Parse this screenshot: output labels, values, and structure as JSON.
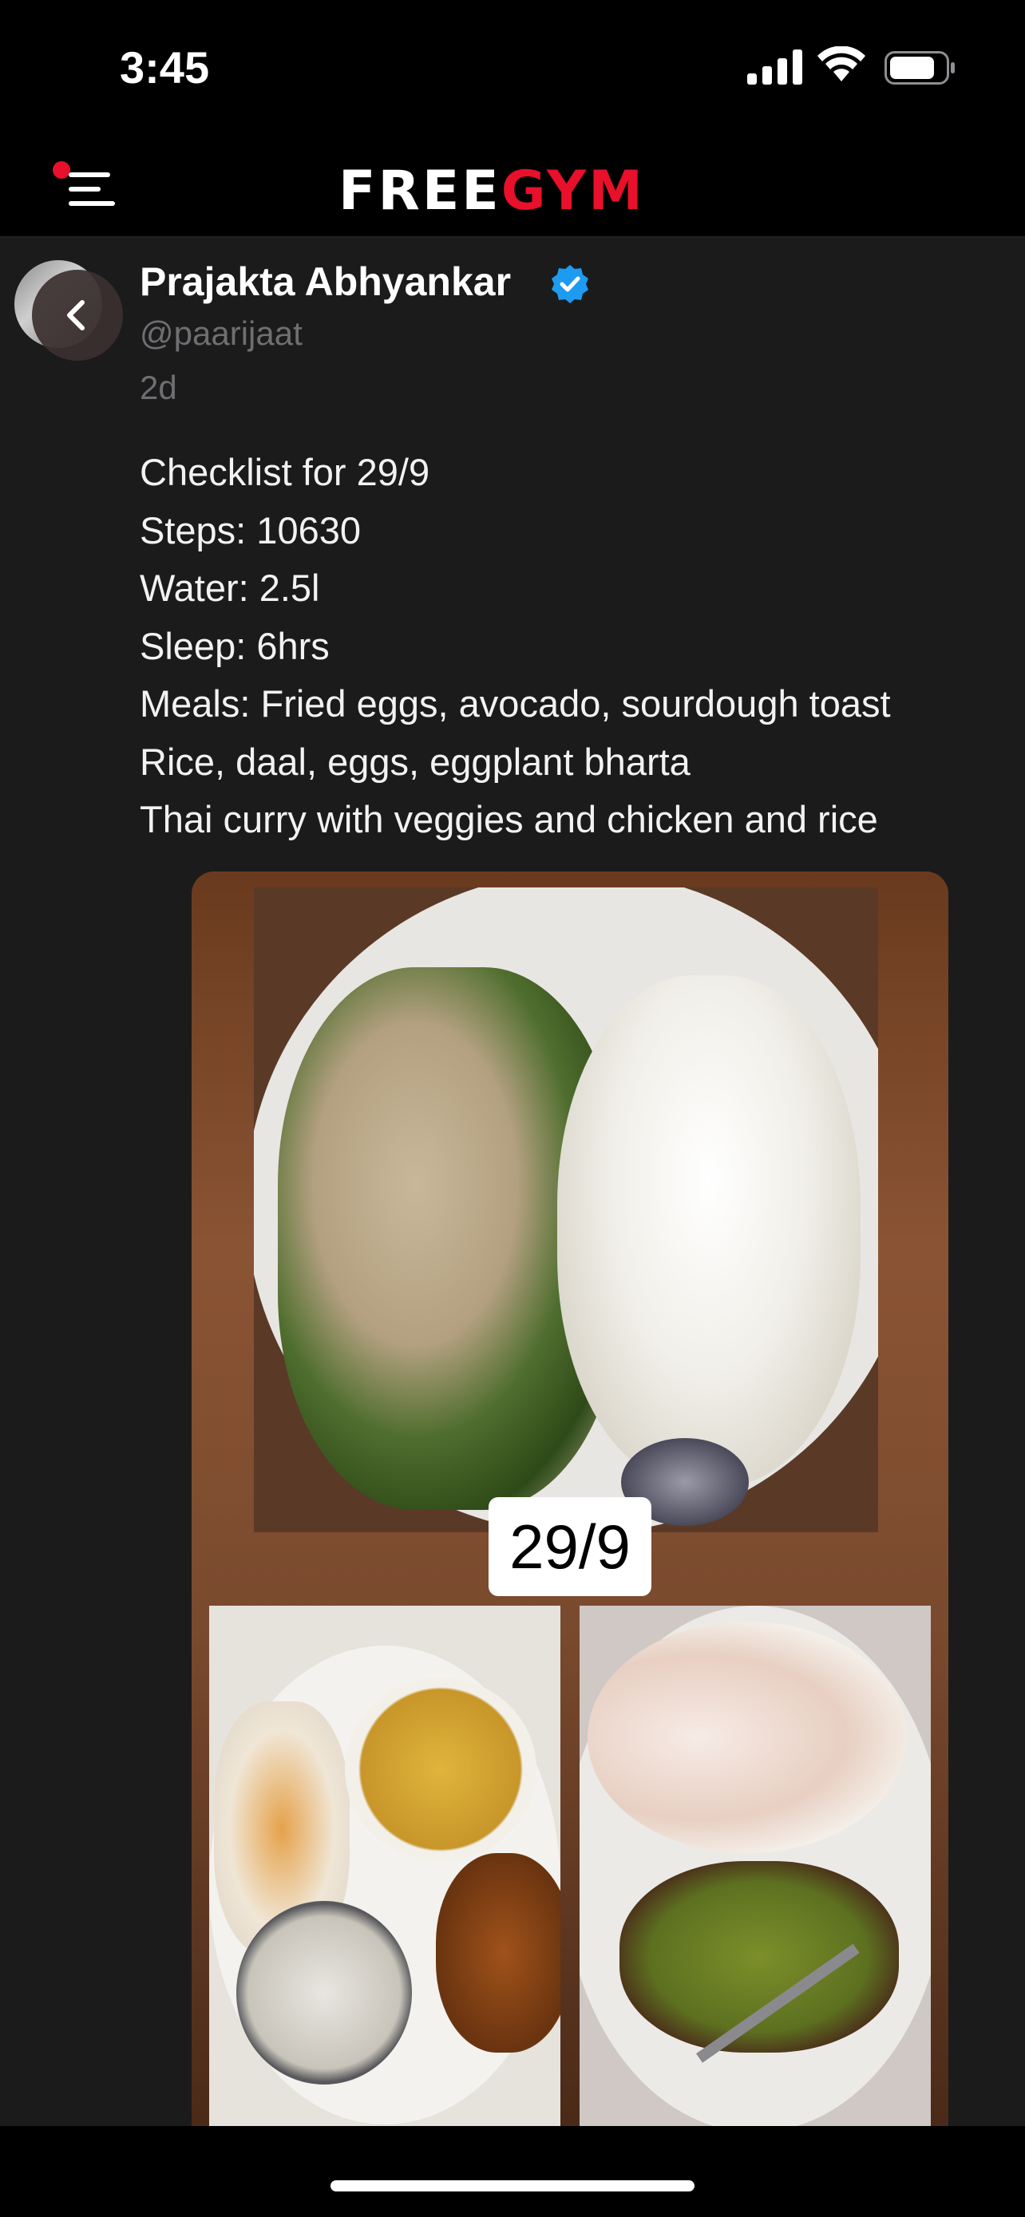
{
  "status_bar": {
    "time": "3:45"
  },
  "app": {
    "logo_part1": "FREE",
    "logo_part2": "GYM",
    "accent_color": "#e8102a"
  },
  "post": {
    "author_name": "Prajakta Abhyankar",
    "handle": "@paarijaat",
    "time_ago": "2d",
    "verified": true,
    "lines": [
      "Checklist for 29/9",
      "Steps: 10630",
      "Water: 2.5l",
      "Sleep: 6hrs",
      "Meals: Fried eggs, avocado, sourdough toast",
      "Rice, daal, eggs, eggplant bharta",
      "Thai curry with veggies and chicken and rice"
    ],
    "image_label": "29/9"
  },
  "icons": {
    "menu": "hamburger-menu-icon",
    "back": "chevron-left-icon",
    "verified": "verified-badge-icon",
    "signal": "cellular-signal-icon",
    "wifi": "wifi-icon",
    "battery": "battery-icon"
  }
}
